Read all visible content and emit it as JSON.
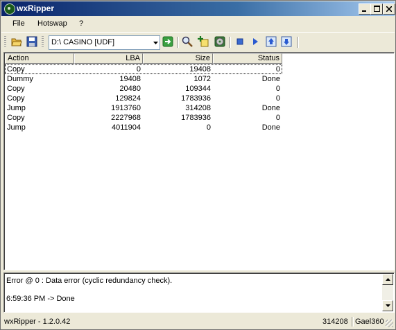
{
  "window": {
    "title": "wxRipper"
  },
  "menu": {
    "items": [
      "File",
      "Hotswap",
      "?"
    ]
  },
  "toolbar": {
    "drive_combo_value": "D:\\ CASINO [UDF]",
    "icons": [
      "open-folder-icon",
      "save-disk-icon",
      "go-arrow-icon",
      "search-magnifier-icon",
      "add-item-icon",
      "disc-icon",
      "stop-icon",
      "play-icon",
      "upload-icon",
      "download-icon"
    ]
  },
  "list": {
    "columns": [
      "Action",
      "LBA",
      "Size",
      "Status"
    ],
    "rows": [
      {
        "action": "Copy",
        "lba": "0",
        "size": "19408",
        "status": "0"
      },
      {
        "action": "Dummy",
        "lba": "19408",
        "size": "1072",
        "status": "Done"
      },
      {
        "action": "Copy",
        "lba": "20480",
        "size": "109344",
        "status": "0"
      },
      {
        "action": "Copy",
        "lba": "129824",
        "size": "1783936",
        "status": "0"
      },
      {
        "action": "Jump",
        "lba": "1913760",
        "size": "314208",
        "status": "Done"
      },
      {
        "action": "Copy",
        "lba": "2227968",
        "size": "1783936",
        "status": "0"
      },
      {
        "action": "Jump",
        "lba": "4011904",
        "size": "0",
        "status": "Done"
      }
    ]
  },
  "log": {
    "lines": [
      "Error @ 0 : Data error (cyclic redundancy check).",
      "6:59:36 PM -> Done"
    ]
  },
  "status": {
    "version": "wxRipper - 1.2.0.42",
    "value": "314208",
    "user": "Gael360"
  }
}
